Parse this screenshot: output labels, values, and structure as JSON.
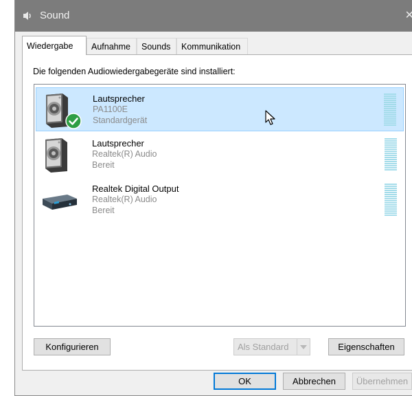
{
  "window": {
    "title": "Sound",
    "close_glyph": "✕"
  },
  "tabs": [
    {
      "label": "Wiedergabe",
      "active": true
    },
    {
      "label": "Aufnahme",
      "active": false
    },
    {
      "label": "Sounds",
      "active": false
    },
    {
      "label": "Kommunikation",
      "active": false
    }
  ],
  "instruction": "Die folgenden Audiowiedergabegeräte sind installiert:",
  "devices": [
    {
      "name": "Lautsprecher",
      "description": "PA1100E",
      "status": "Standardgerät",
      "icon": "speaker-icon",
      "selected": true,
      "default_badge": "check-badge-icon"
    },
    {
      "name": "Lautsprecher",
      "description": "Realtek(R) Audio",
      "status": "Bereit",
      "icon": "speaker-icon",
      "selected": false
    },
    {
      "name": "Realtek Digital Output",
      "description": "Realtek(R) Audio",
      "status": "Bereit",
      "icon": "digital-output-icon",
      "selected": false
    }
  ],
  "buttons": {
    "configure": "Konfigurieren",
    "set_default": "Als Standard",
    "properties": "Eigenschaften",
    "ok": "OK",
    "cancel": "Abbrechen",
    "apply": "Übernehmen"
  },
  "colors": {
    "selection_bg": "#cce8ff",
    "selection_border": "#99d1ff",
    "meter": "#a4dcea",
    "default_check": "#2e9e44",
    "titlebar": "#7c7c7c"
  }
}
